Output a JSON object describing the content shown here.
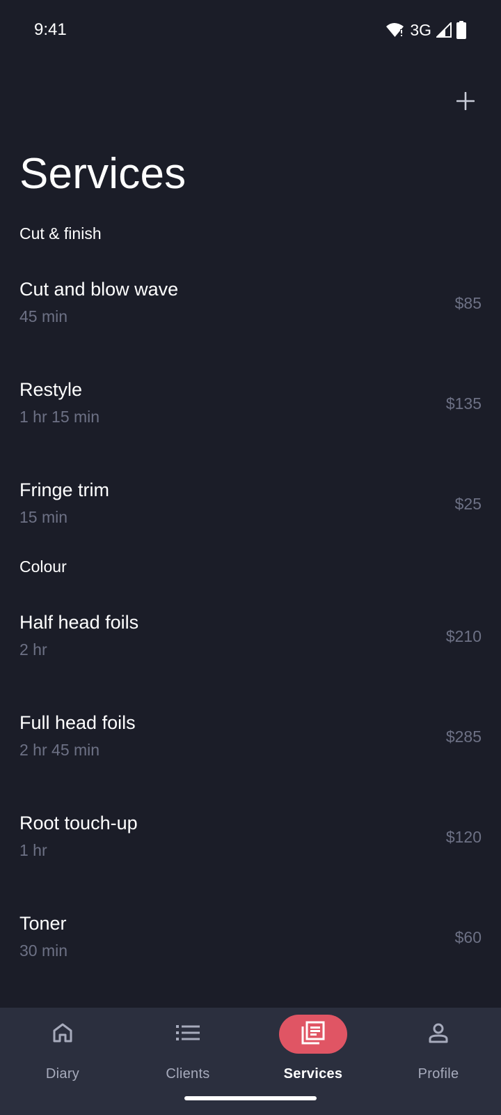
{
  "status": {
    "time": "9:41",
    "network": "3G"
  },
  "header": {
    "title": "Services",
    "add_icon": "plus-icon"
  },
  "sections": [
    {
      "title": "Cut & finish",
      "services": [
        {
          "name": "Cut and blow wave",
          "duration": "45 min",
          "price": "$85"
        },
        {
          "name": "Restyle",
          "duration": "1 hr 15 min",
          "price": "$135"
        },
        {
          "name": "Fringe trim",
          "duration": "15 min",
          "price": "$25"
        }
      ]
    },
    {
      "title": "Colour",
      "services": [
        {
          "name": "Half head foils",
          "duration": "2 hr",
          "price": "$210"
        },
        {
          "name": "Full head foils",
          "duration": "2 hr 45 min",
          "price": "$285"
        },
        {
          "name": "Root touch-up",
          "duration": "1 hr",
          "price": "$120"
        },
        {
          "name": "Toner",
          "duration": "30 min",
          "price": "$60"
        }
      ]
    }
  ],
  "nav": {
    "items": [
      {
        "label": "Diary",
        "icon": "home-icon",
        "active": false
      },
      {
        "label": "Clients",
        "icon": "list-icon",
        "active": false
      },
      {
        "label": "Services",
        "icon": "services-icon",
        "active": true
      },
      {
        "label": "Profile",
        "icon": "person-icon",
        "active": false
      }
    ]
  },
  "colors": {
    "background": "#1b1d28",
    "nav_background": "#2b2f3e",
    "accent": "#e05564",
    "muted_text": "#6d7185"
  }
}
